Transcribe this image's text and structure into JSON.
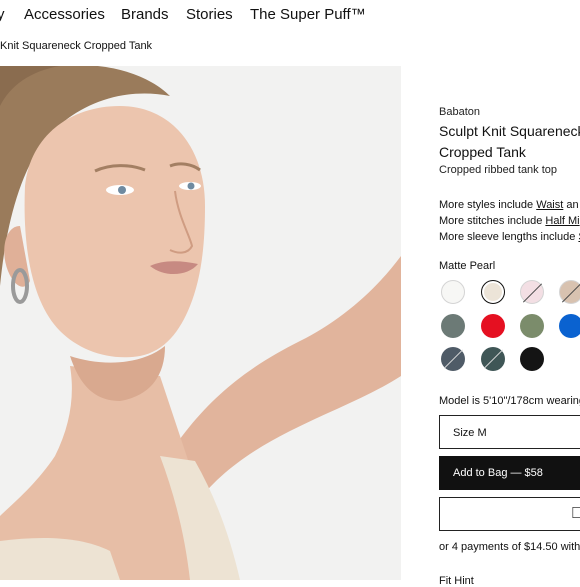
{
  "nav": {
    "items": [
      {
        "label": "y"
      },
      {
        "label": "Accessories"
      },
      {
        "label": "Brands"
      },
      {
        "label": "Stories"
      },
      {
        "label": "The Super Puff™"
      }
    ]
  },
  "breadcrumb": {
    "current": "Knit Squareneck Cropped Tank"
  },
  "product": {
    "brand": "Babaton",
    "title": "Sculpt Knit Squareneck Cropped Tank",
    "subtitle": "Cropped ribbed tank top",
    "more_styles": {
      "prefix": "More styles include ",
      "link": "Waist",
      "suffix": " an"
    },
    "more_stitches": {
      "prefix": "More stitches include ",
      "link": "Half Mi"
    },
    "more_sleeves": {
      "prefix": "More sleeve lengths include ",
      "link": "S"
    },
    "selected_color": "Matte Pearl",
    "swatches": [
      {
        "name": "white",
        "color": "#f7f7f5",
        "unavailable": false
      },
      {
        "name": "matte-pearl",
        "color": "#ece4d8",
        "unavailable": false,
        "selected": true
      },
      {
        "name": "pink",
        "color": "#f3dfe4",
        "unavailable": true
      },
      {
        "name": "tan",
        "color": "#d8c2b0",
        "unavailable": true
      },
      {
        "name": "sage-grey",
        "color": "#6c7a76",
        "unavailable": false
      },
      {
        "name": "red",
        "color": "#e51021",
        "unavailable": false
      },
      {
        "name": "olive",
        "color": "#7b8c6b",
        "unavailable": false
      },
      {
        "name": "blue",
        "color": "#0a62d0",
        "unavailable": false
      },
      {
        "name": "slate",
        "color": "#4f5b67",
        "unavailable": true
      },
      {
        "name": "dark-teal",
        "color": "#3f5656",
        "unavailable": true
      },
      {
        "name": "black-stripe",
        "color": "#141414",
        "unavailable": false
      }
    ],
    "model_info": "Model is 5'10\"/178cm wearing",
    "size_label": "Size M",
    "add_to_bag": "Add to Bag — $58",
    "pay_icon": "apple-icon",
    "installments": "or 4 payments of $14.50 with",
    "fit_label": "Fit Hint"
  }
}
